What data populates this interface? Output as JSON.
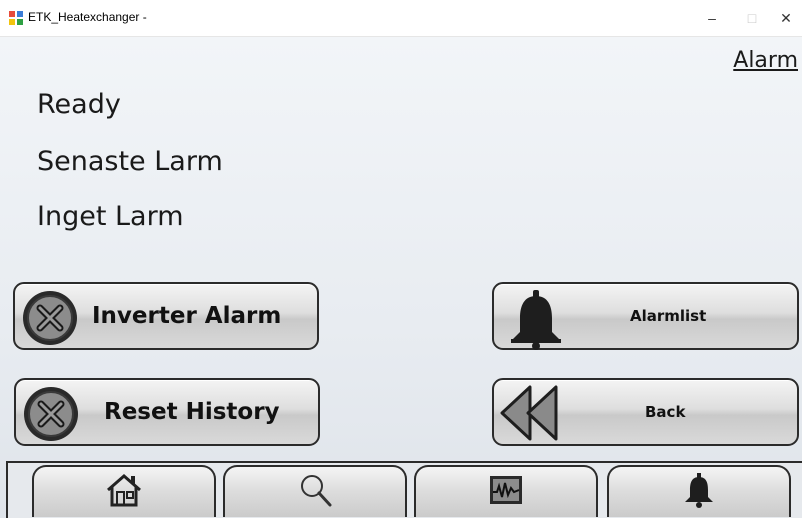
{
  "window": {
    "title": "ETK_Heatexchanger -",
    "controls": {
      "minimize": "–",
      "maximize": "□",
      "close": "✕"
    }
  },
  "header": {
    "alarm_link": "Alarm"
  },
  "status": {
    "state": "Ready",
    "last_alarm_label": "Senaste Larm",
    "last_alarm_value": "Inget Larm"
  },
  "buttons": {
    "inverter_alarm": "Inverter Alarm",
    "reset_history": "Reset History",
    "alarmlist": "Alarmlist",
    "back": "Back"
  },
  "icons": {
    "x_circle": "x-circle-icon",
    "bell": "bell-icon",
    "rewind": "rewind-icon",
    "home": "home-icon",
    "search": "search-icon",
    "trend": "trend-monitor-icon"
  },
  "colors": {
    "background_top": "#f2f5f8",
    "background_bottom": "#dfe4ea",
    "button_border": "#2b2b2b",
    "icon_dark": "#1e1e1e"
  }
}
